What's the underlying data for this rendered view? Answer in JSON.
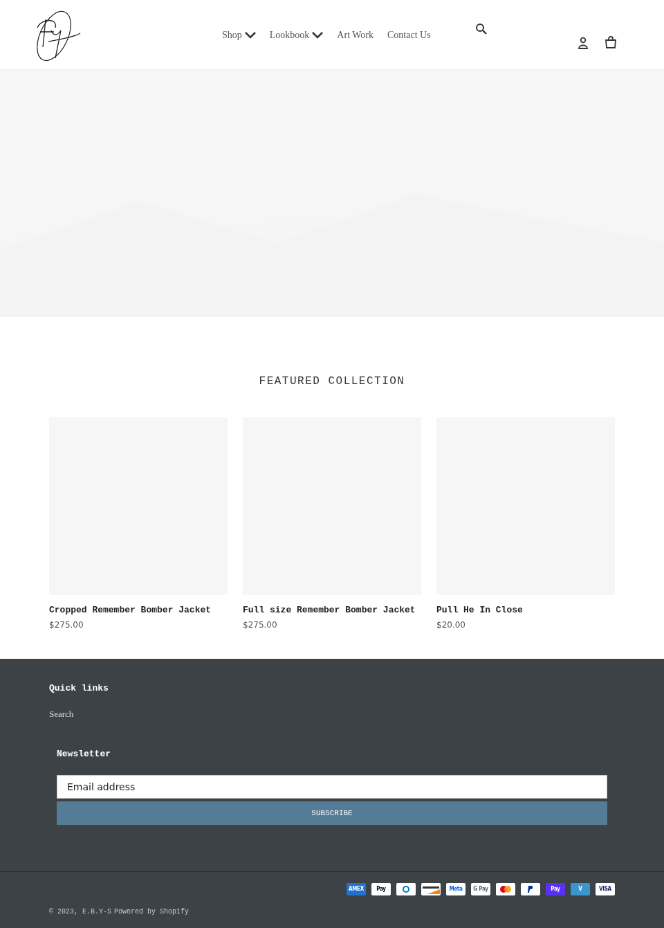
{
  "header": {
    "nav": [
      {
        "label": "Shop",
        "dropdown": true
      },
      {
        "label": "Lookbook",
        "dropdown": true
      },
      {
        "label": "Art Work",
        "dropdown": false
      },
      {
        "label": "Contact Us",
        "dropdown": false
      }
    ]
  },
  "featured": {
    "title": "FEATURED COLLECTION",
    "products": [
      {
        "name": "Cropped Remember Bomber Jacket",
        "price": "$275.00"
      },
      {
        "name": "Full size Remember Bomber Jacket",
        "price": "$275.00"
      },
      {
        "name": "Pull He In Close",
        "price": "$20.00"
      }
    ]
  },
  "footer": {
    "quick_links_title": "Quick links",
    "links": [
      "Search"
    ],
    "newsletter_title": "Newsletter",
    "email_placeholder": "Email address",
    "subscribe": "SUBSCRIBE",
    "payments": [
      {
        "kind": "amex",
        "label": "AMEX"
      },
      {
        "kind": "applepay",
        "label": "Pay"
      },
      {
        "kind": "diners"
      },
      {
        "kind": "discover"
      },
      {
        "kind": "meta",
        "label": "Meta"
      },
      {
        "kind": "gpay",
        "label": "G Pay"
      },
      {
        "kind": "mastercard"
      },
      {
        "kind": "paypal"
      },
      {
        "kind": "shoppay",
        "label": "Pay"
      },
      {
        "kind": "venmo",
        "label": "V"
      },
      {
        "kind": "visa",
        "label": "VISA"
      }
    ],
    "copyright": "© 2023, E.B.Y-S",
    "powered": "Powered by Shopify"
  }
}
